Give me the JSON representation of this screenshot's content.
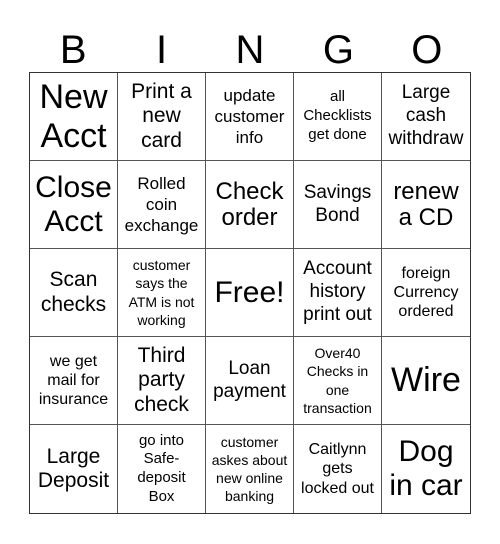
{
  "header": {
    "letters": [
      "B",
      "I",
      "N",
      "G",
      "O"
    ]
  },
  "cells": [
    "New\nAcct",
    "Print a\nnew\ncard",
    "update\ncustomer\ninfo",
    "all\nChecklists\nget done",
    "Large\ncash\nwithdraw",
    "Close\nAcct",
    "Rolled\ncoin\nexchange",
    "Check\norder",
    "Savings\nBond",
    "renew\na CD",
    "Scan\nchecks",
    "customer\nsays the\nATM is not\nworking",
    "Free!",
    "Account\nhistory\nprint out",
    "foreign\nCurrency\nordered",
    "we get\nmail for\ninsurance",
    "Third\nparty\ncheck",
    "Loan\npayment",
    "Over40\nChecks in\none\ntransaction",
    "Wire",
    "Large\nDeposit",
    "go into\nSafe-\ndeposit\nBox",
    "customer\naskes about\nnew online\nbanking",
    "Caitlynn\ngets\nlocked out",
    "Dog\nin car"
  ]
}
